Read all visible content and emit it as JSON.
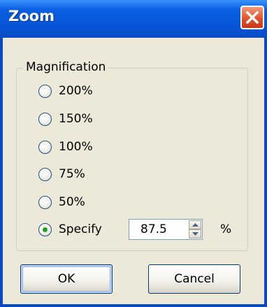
{
  "window": {
    "title": "Zoom"
  },
  "magnification": {
    "label": "Magnification",
    "options": [
      {
        "label": "200%",
        "checked": false
      },
      {
        "label": "150%",
        "checked": false
      },
      {
        "label": "100%",
        "checked": false
      },
      {
        "label": "75%",
        "checked": false
      },
      {
        "label": "50%",
        "checked": false
      },
      {
        "label": "Specify",
        "checked": true
      }
    ],
    "specify_value": "87.5",
    "unit": "%"
  },
  "buttons": {
    "ok": "OK",
    "cancel": "Cancel"
  },
  "icons": {
    "close": "close-icon",
    "spin_up": "arrow-up-icon",
    "spin_down": "arrow-down-icon"
  }
}
